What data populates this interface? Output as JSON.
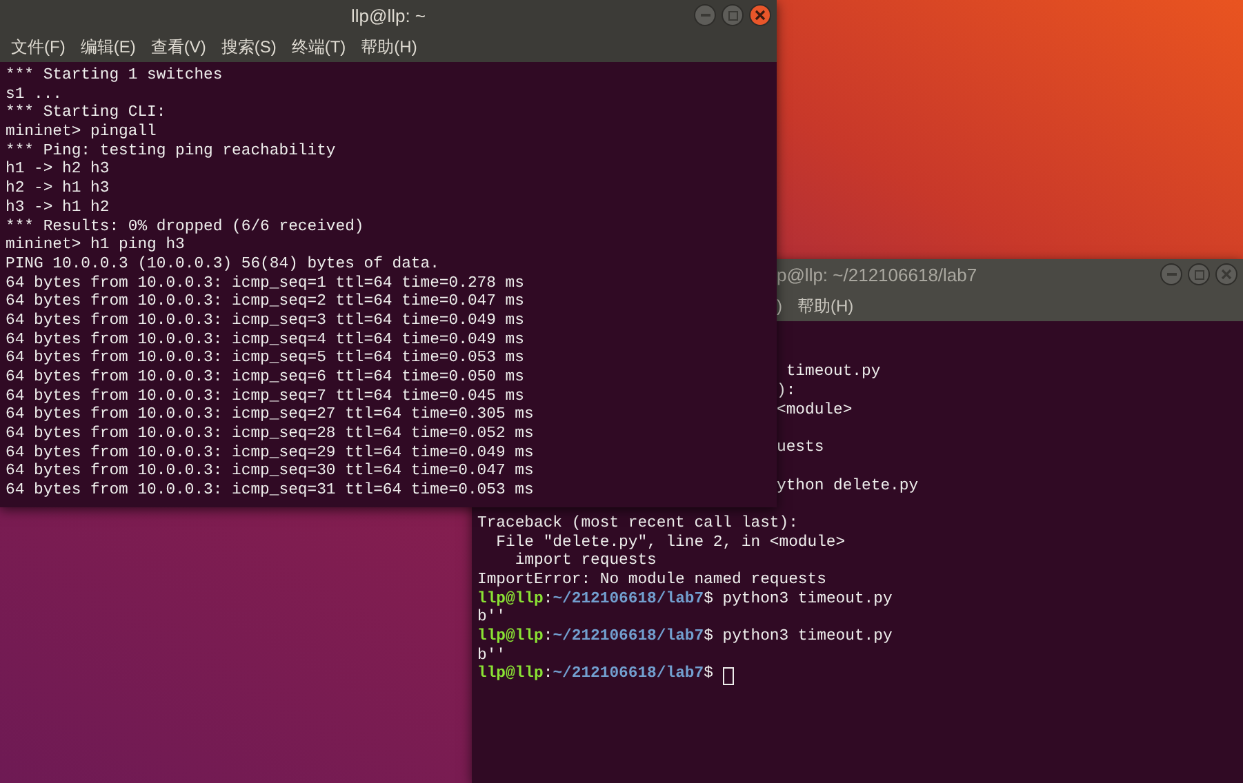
{
  "front_window": {
    "title": "llp@llp: ~",
    "active": true,
    "menu": [
      "文件(F)",
      "编辑(E)",
      "查看(V)",
      "搜索(S)",
      "终端(T)",
      "帮助(H)"
    ],
    "lines": [
      {
        "kind": "output",
        "text": "*** Starting 1 switches"
      },
      {
        "kind": "output",
        "text": "s1 ..."
      },
      {
        "kind": "output",
        "text": "*** Starting CLI:"
      },
      {
        "kind": "output",
        "text": "mininet> pingall"
      },
      {
        "kind": "output",
        "text": "*** Ping: testing ping reachability"
      },
      {
        "kind": "output",
        "text": "h1 -> h2 h3"
      },
      {
        "kind": "output",
        "text": "h2 -> h1 h3"
      },
      {
        "kind": "output",
        "text": "h3 -> h1 h2"
      },
      {
        "kind": "output",
        "text": "*** Results: 0% dropped (6/6 received)"
      },
      {
        "kind": "output",
        "text": "mininet> h1 ping h3"
      },
      {
        "kind": "output",
        "text": "PING 10.0.0.3 (10.0.0.3) 56(84) bytes of data."
      },
      {
        "kind": "output",
        "text": "64 bytes from 10.0.0.3: icmp_seq=1 ttl=64 time=0.278 ms"
      },
      {
        "kind": "output",
        "text": "64 bytes from 10.0.0.3: icmp_seq=2 ttl=64 time=0.047 ms"
      },
      {
        "kind": "output",
        "text": "64 bytes from 10.0.0.3: icmp_seq=3 ttl=64 time=0.049 ms"
      },
      {
        "kind": "output",
        "text": "64 bytes from 10.0.0.3: icmp_seq=4 ttl=64 time=0.049 ms"
      },
      {
        "kind": "output",
        "text": "64 bytes from 10.0.0.3: icmp_seq=5 ttl=64 time=0.053 ms"
      },
      {
        "kind": "output",
        "text": "64 bytes from 10.0.0.3: icmp_seq=6 ttl=64 time=0.050 ms"
      },
      {
        "kind": "output",
        "text": "64 bytes from 10.0.0.3: icmp_seq=7 ttl=64 time=0.045 ms"
      },
      {
        "kind": "output",
        "text": "64 bytes from 10.0.0.3: icmp_seq=27 ttl=64 time=0.305 ms"
      },
      {
        "kind": "output",
        "text": "64 bytes from 10.0.0.3: icmp_seq=28 ttl=64 time=0.052 ms"
      },
      {
        "kind": "output",
        "text": "64 bytes from 10.0.0.3: icmp_seq=29 ttl=64 time=0.049 ms"
      },
      {
        "kind": "output",
        "text": "64 bytes from 10.0.0.3: icmp_seq=30 ttl=64 time=0.047 ms"
      },
      {
        "kind": "output",
        "text": "64 bytes from 10.0.0.3: icmp_seq=31 ttl=64 time=0.053 ms"
      }
    ]
  },
  "back_window": {
    "title": "p@llp: ~/212106618/lab7",
    "active": false,
    "menu": [
      ")",
      "帮助(H)"
    ],
    "lines": [
      {
        "kind": "blank"
      },
      {
        "kind": "blank"
      },
      {
        "kind": "partial",
        "text": " timeout.py"
      },
      {
        "kind": "partial",
        "text": "):"
      },
      {
        "kind": "partial",
        "text": "<module>"
      },
      {
        "kind": "blank"
      },
      {
        "kind": "partial",
        "text": "uests"
      },
      {
        "kind": "blank"
      },
      {
        "kind": "partial",
        "text": "ython delete.py"
      },
      {
        "kind": "blank"
      },
      {
        "kind": "output",
        "text": "Traceback (most recent call last):"
      },
      {
        "kind": "output",
        "text": "  File \"delete.py\", line 2, in <module>"
      },
      {
        "kind": "output",
        "text": "    import requests"
      },
      {
        "kind": "output",
        "text": "ImportError: No module named requests"
      },
      {
        "kind": "prompt",
        "user": "llp@llp",
        "sep": ":",
        "path": "~/212106618/lab7",
        "tail": "$ python3 timeout.py",
        "cursor": false
      },
      {
        "kind": "output",
        "text": "b''"
      },
      {
        "kind": "prompt",
        "user": "llp@llp",
        "sep": ":",
        "path": "~/212106618/lab7",
        "tail": "$ python3 timeout.py",
        "cursor": false
      },
      {
        "kind": "output",
        "text": "b''"
      },
      {
        "kind": "prompt",
        "user": "llp@llp",
        "sep": ":",
        "path": "~/212106618/lab7",
        "tail": "$ ",
        "cursor": true
      }
    ]
  }
}
